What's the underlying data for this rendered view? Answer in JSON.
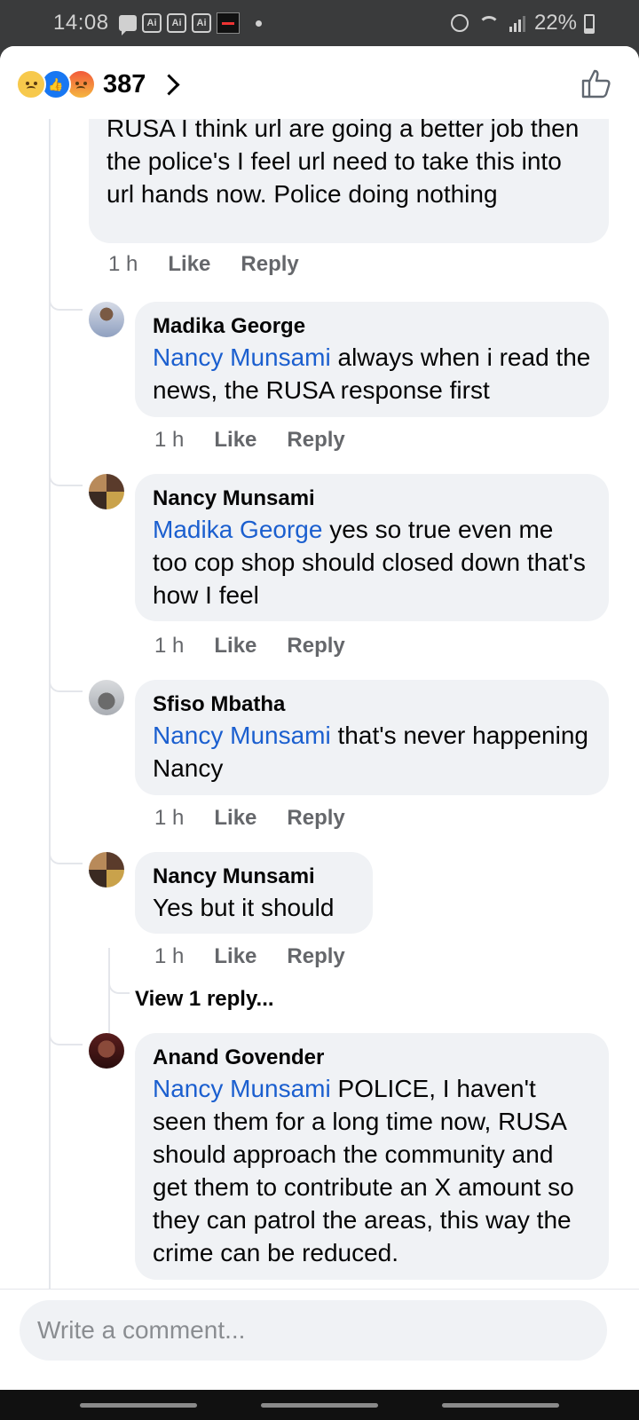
{
  "status_bar": {
    "time": "14:08",
    "ai_badges": [
      "Ai",
      "Ai",
      "Ai"
    ],
    "battery": "22%"
  },
  "header": {
    "reaction_icons": [
      "sad-reaction",
      "like-reaction",
      "angry-reaction"
    ],
    "reaction_count": "387"
  },
  "comments": {
    "c0": {
      "text": "RUSA I think url are going a better job then the police's I feel url need to take this into url hands now. Police doing nothing",
      "time": "1 h",
      "like": "Like",
      "reply": "Reply"
    },
    "c1": {
      "name": "Madika George",
      "mention": "Nancy Munsami",
      "text": " always when i read the news, the RUSA response first",
      "time": "1 h",
      "like": "Like",
      "reply": "Reply"
    },
    "c2": {
      "name": "Nancy Munsami",
      "mention": "Madika George",
      "text": " yes so true even me too cop shop should closed down that's how I feel",
      "time": "1 h",
      "like": "Like",
      "reply": "Reply"
    },
    "c3": {
      "name": "Sfiso Mbatha",
      "mention": "Nancy Munsami",
      "text": " that's never happening Nancy",
      "time": "1 h",
      "like": "Like",
      "reply": "Reply"
    },
    "c4": {
      "name": "Nancy Munsami",
      "text": "Yes but it should",
      "time": "1 h",
      "like": "Like",
      "reply": "Reply",
      "view_replies": "View 1 reply..."
    },
    "c5": {
      "name": "Anand Govender",
      "mention": "Nancy Munsami",
      "text": " POLICE, I haven't seen them for a long time now, RUSA should approach the community and get them to contribute an X amount so they can patrol the areas, this way the crime can be reduced."
    }
  },
  "composer": {
    "placeholder": "Write a comment..."
  }
}
